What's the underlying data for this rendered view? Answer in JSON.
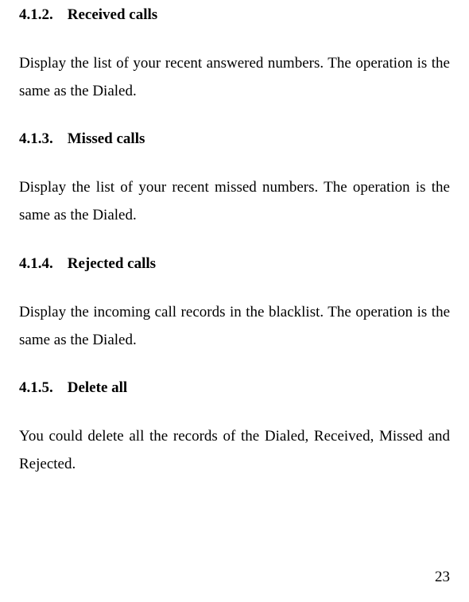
{
  "sections": [
    {
      "number": "4.1.2.",
      "title": "Received calls",
      "body": "Display the list of your recent answered numbers. The operation is the same as the Dialed."
    },
    {
      "number": "4.1.3.",
      "title": "Missed calls",
      "body": "Display the list of your recent missed numbers. The operation is the same as the Dialed."
    },
    {
      "number": "4.1.4.",
      "title": "Rejected calls",
      "body": "Display the incoming call records in the blacklist. The operation is the same as the Dialed."
    },
    {
      "number": "4.1.5.",
      "title": "Delete all",
      "body": "You could delete all the records of the Dialed, Received, Missed and Rejected."
    }
  ],
  "page_number": "23"
}
